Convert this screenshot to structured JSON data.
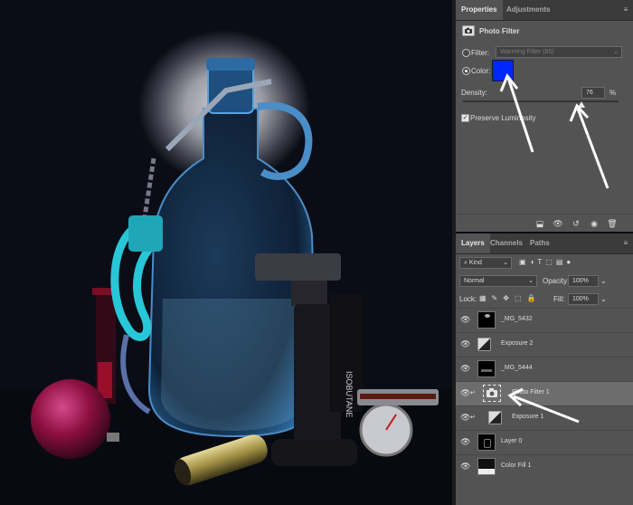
{
  "properties": {
    "tabs": [
      {
        "label": "Properties",
        "active": true
      },
      {
        "label": "Adjustments",
        "active": false
      }
    ],
    "title": "Photo Filter",
    "title_icon": "camera-filter-icon",
    "filter_label": "Filter:",
    "filter_value": "Warming Filter (85)",
    "color_label": "Color:",
    "color_value": "#0027ff",
    "density_label": "Density:",
    "density_value": "76",
    "density_unit": "%",
    "density_fraction": 0.76,
    "preserve_label": "Preserve Luminosity",
    "preserve_checked": true,
    "footer_icons": [
      "clip-to-layer-icon",
      "view-previous-icon",
      "reset-icon",
      "visibility-icon",
      "trash-icon"
    ]
  },
  "layers_panel": {
    "tabs": [
      {
        "label": "Layers",
        "active": true
      },
      {
        "label": "Channels",
        "active": false
      },
      {
        "label": "Paths",
        "active": false
      }
    ],
    "kind_label": "Kind",
    "blend_mode": "Normal",
    "opacity_label": "Opacity:",
    "opacity_value": "100%",
    "lock_label": "Lock:",
    "fill_label": "Fill:",
    "fill_value": "100%",
    "layers": [
      {
        "name": "_MG_5432",
        "type": "image",
        "selected": false,
        "clipped": false
      },
      {
        "name": "Exposure 2",
        "type": "adjustment",
        "selected": false,
        "clipped": false
      },
      {
        "name": "_MG_5444",
        "type": "image",
        "selected": false,
        "clipped": false
      },
      {
        "name": "Photo Filter 1",
        "type": "adjustment",
        "selected": true,
        "clipped": true
      },
      {
        "name": "Exposure 1",
        "type": "adjustment",
        "selected": false,
        "clipped": true
      },
      {
        "name": "Layer 0",
        "type": "image",
        "selected": false,
        "clipped": false
      },
      {
        "name": "Color Fill 1",
        "type": "fill",
        "selected": false,
        "clipped": false
      }
    ]
  },
  "canvas": {
    "accent_colors": {
      "bottle": "#3b86c4",
      "handcuff": "#27c7d8",
      "ornament": "#8c0f40",
      "arrow": "#ffffff"
    },
    "product_label": "ISOBUTANE"
  }
}
